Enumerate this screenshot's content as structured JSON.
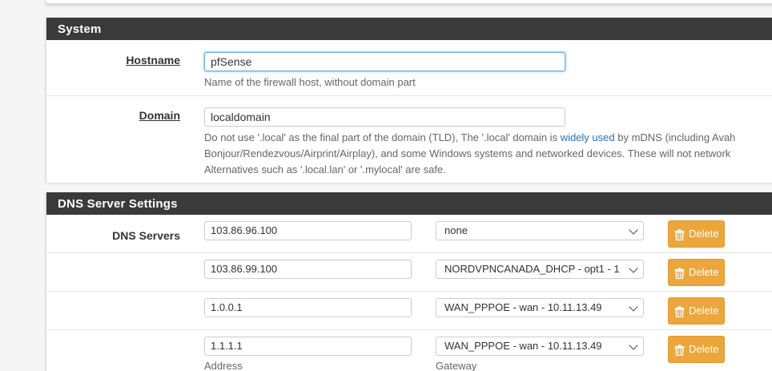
{
  "system": {
    "heading": "System",
    "hostname": {
      "label": "Hostname",
      "value": "pfSense",
      "help": "Name of the firewall host, without domain part"
    },
    "domain": {
      "label": "Domain",
      "value": "localdomain",
      "help_line1_pre": "Do not use '.local' as the final part of the domain (TLD), The '.local' domain is ",
      "help_link": "widely used",
      "help_line1_post": " by mDNS (including Avah",
      "help_line2": "Bonjour/Rendezvous/Airprint/Airplay), and some Windows systems and networked devices. These will not network",
      "help_line3": "Alternatives such as '.local.lan' or '.mylocal' are safe."
    }
  },
  "dns": {
    "heading": "DNS Server Settings",
    "servers_label": "DNS Servers",
    "delete_label": "Delete",
    "address_caption": "Address",
    "gateway_caption": "Gateway",
    "rows": [
      {
        "address": "103.86.96.100",
        "gateway": "none"
      },
      {
        "address": "103.86.99.100",
        "gateway": "NORDVPNCANADA_DHCP - opt1 - 1"
      },
      {
        "address": "1.0.0.1",
        "gateway": "WAN_PPPOE - wan - 10.11.13.49"
      },
      {
        "address": "1.1.1.1",
        "gateway": "WAN_PPPOE - wan - 10.11.13.49"
      }
    ]
  },
  "icons": {
    "select_arrow": "chevron-down-icon",
    "delete": "trash-icon"
  },
  "colors": {
    "heading_bg": "#3a3a3a",
    "delete_button": "#eca63c",
    "link": "#2a6ebb",
    "focus_border": "#66afe9"
  }
}
